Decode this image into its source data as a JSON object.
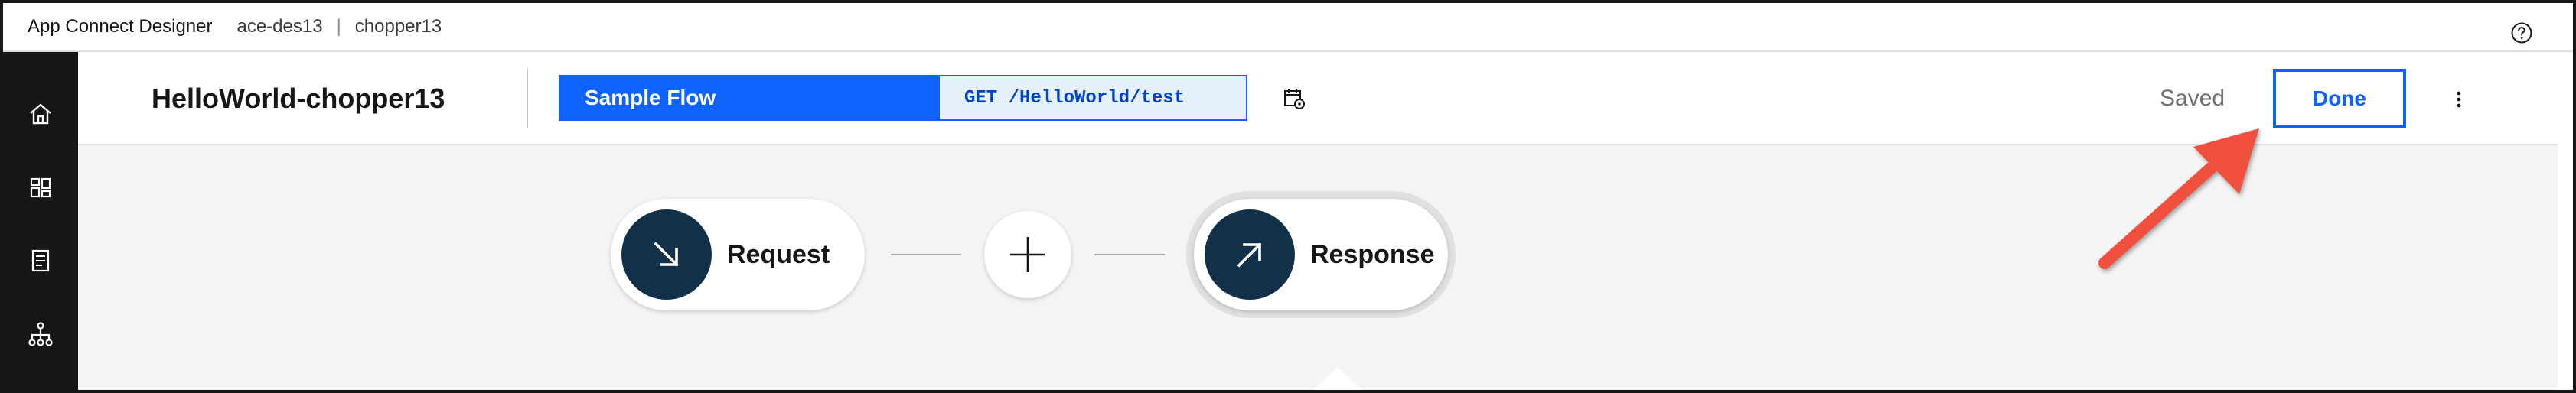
{
  "header": {
    "app_name": "App Connect Designer",
    "instance": "ace-des13",
    "separator": "|",
    "user": "chopper13",
    "help_icon": "help-circle-icon"
  },
  "sidebar": {
    "items": [
      {
        "name": "home",
        "icon": "home-icon"
      },
      {
        "name": "dashboard",
        "icon": "dashboard-icon"
      },
      {
        "name": "catalog",
        "icon": "catalog-icon"
      },
      {
        "name": "apis",
        "icon": "network-icon"
      }
    ]
  },
  "flow": {
    "title": "HelloWorld-chopper13",
    "type_label": "Sample Flow",
    "endpoint": "GET /HelloWorld/test",
    "status": "Saved",
    "done_label": "Done",
    "calendar_icon": "calendar-settings-icon",
    "overflow_icon": "overflow-menu-icon"
  },
  "canvas": {
    "request_label": "Request",
    "response_label": "Response",
    "add_icon": "add-icon"
  },
  "colors": {
    "accent": "#0f62fe",
    "node": "#123148",
    "rail": "#161616",
    "annotation": "#f0503c"
  }
}
